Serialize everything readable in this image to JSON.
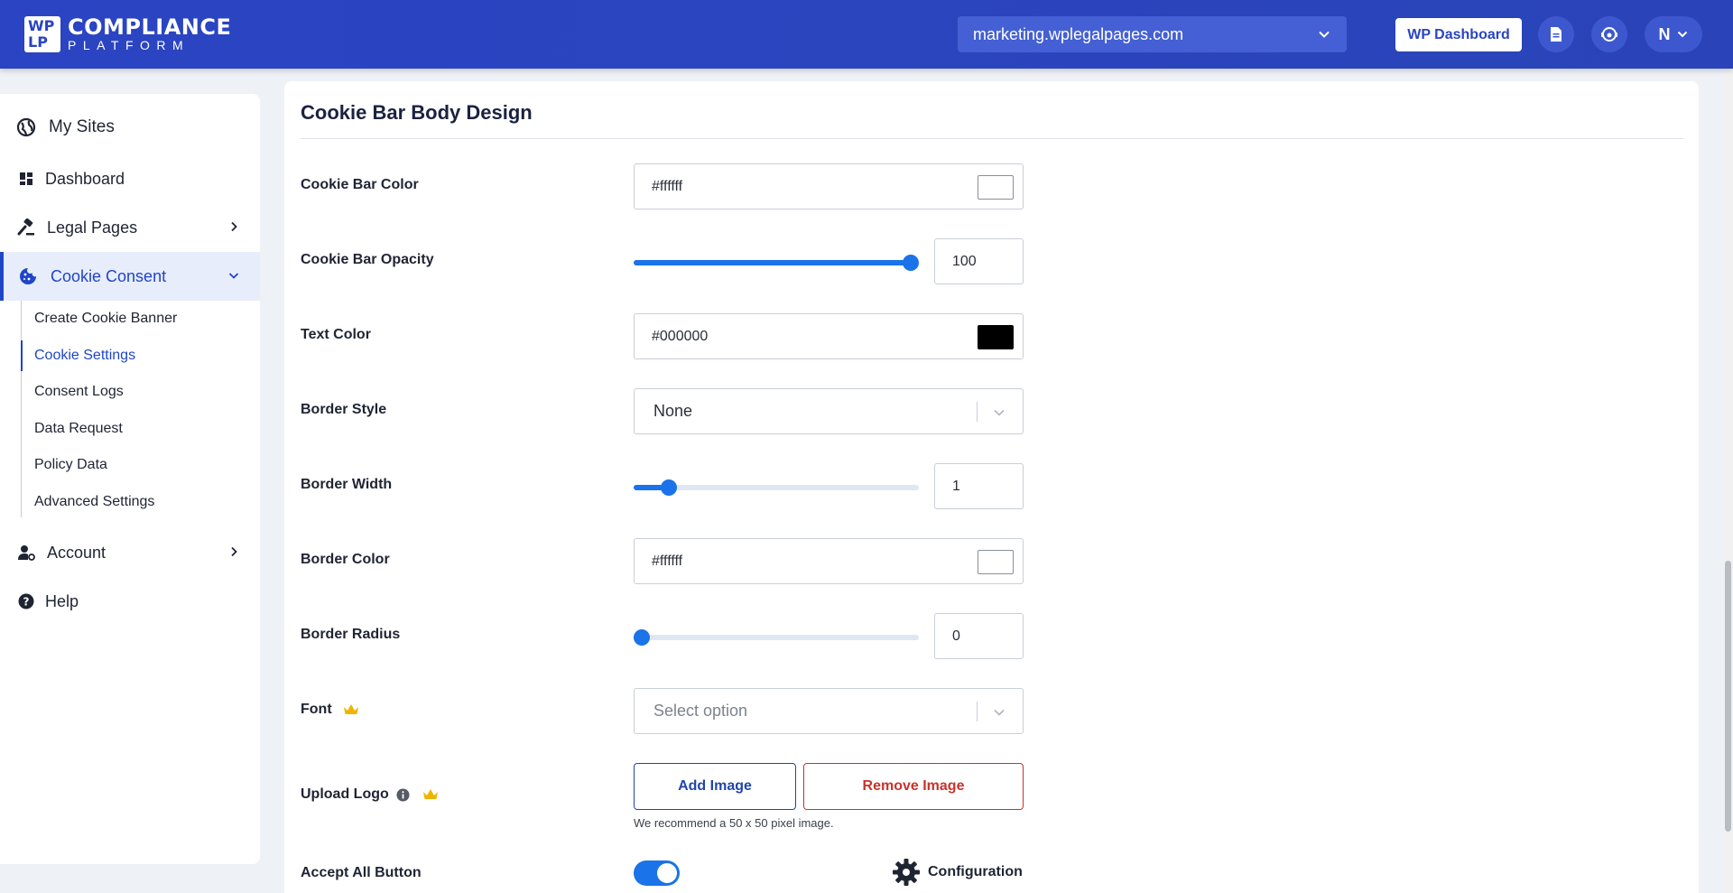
{
  "header": {
    "logo_mark": "WP LP",
    "logo_title": "COMPLIANCE",
    "logo_subtitle": "PLATFORM",
    "site_selector": "marketing.wplegalpages.com",
    "wp_dashboard_label": "WP Dashboard",
    "user_initial": "N",
    "brand_color": "#2a44c3"
  },
  "sidebar": {
    "items": [
      {
        "label": "My Sites",
        "icon": "globe-icon"
      },
      {
        "label": "Dashboard",
        "icon": "grid-icon"
      },
      {
        "label": "Legal Pages",
        "icon": "gavel-icon"
      },
      {
        "label": "Cookie Consent",
        "icon": "cookie-icon"
      },
      {
        "label": "Account",
        "icon": "user-gear-icon"
      },
      {
        "label": "Help",
        "icon": "question-icon"
      }
    ],
    "cookie_submenu": [
      "Create Cookie Banner",
      "Cookie Settings",
      "Consent Logs",
      "Data Request",
      "Policy Data",
      "Advanced Settings"
    ],
    "active_item": "Cookie Consent",
    "active_subitem": "Cookie Settings"
  },
  "panel": {
    "title": "Cookie Bar Body Design",
    "cookie_bar_color": {
      "label": "Cookie Bar Color",
      "value": "#ffffff",
      "swatch": "#ffffff"
    },
    "cookie_bar_opacity": {
      "label": "Cookie Bar Opacity",
      "value": "100",
      "level": 1.0
    },
    "text_color": {
      "label": "Text Color",
      "value": "#000000",
      "swatch": "#000000"
    },
    "border_style": {
      "label": "Border Style",
      "value": "None"
    },
    "border_width": {
      "label": "Border Width",
      "value": "1",
      "level": 0.1
    },
    "border_color": {
      "label": "Border Color",
      "value": "#ffffff",
      "swatch": "#ffffff"
    },
    "border_radius": {
      "label": "Border Radius",
      "value": "0",
      "level": 0.0
    },
    "font": {
      "label": "Font",
      "placeholder": "Select option"
    },
    "upload_logo": {
      "label": "Upload Logo",
      "add_label": "Add Image",
      "remove_label": "Remove Image",
      "hint": "We recommend a 50 x 50 pixel image."
    },
    "accept_all": {
      "label": "Accept All Button",
      "toggle_on": true,
      "config_label": "Configuration"
    }
  },
  "colors": {
    "accent": "#1a73e8",
    "danger": "#c8332b",
    "premium": "#f0b400"
  }
}
